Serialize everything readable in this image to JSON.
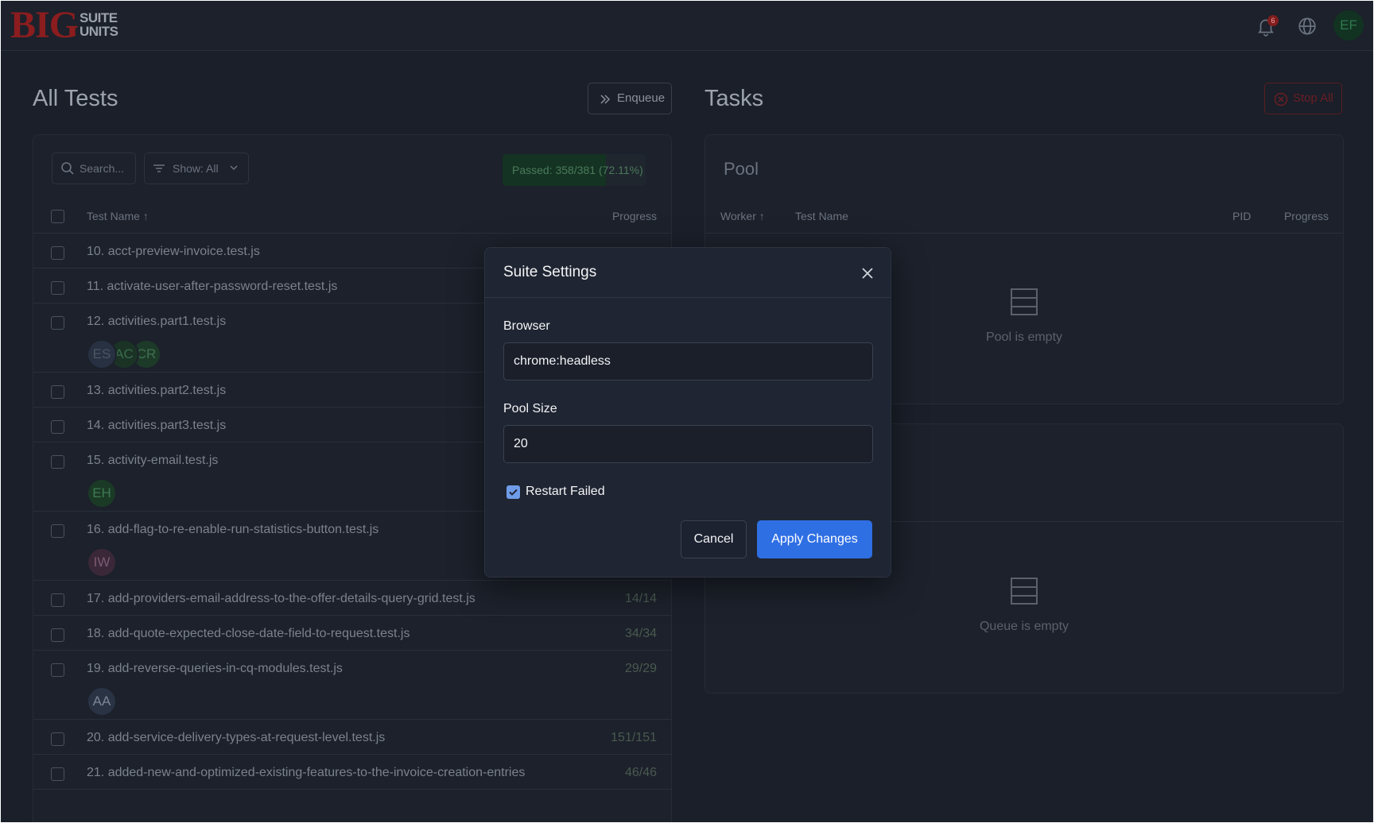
{
  "brand": {
    "big": "BIG",
    "suite": "SUITE",
    "units": "UNITS"
  },
  "header": {
    "notifications_count": "6",
    "user_initials": "EF"
  },
  "all_tests": {
    "title": "All Tests",
    "enqueue_label": "Enqueue",
    "search_placeholder": "Search...",
    "filter_label": "Show: All",
    "passed_summary": "Passed: 358/381 (72.11%)",
    "passed_fraction": 0.72,
    "columns": {
      "test_name": "Test Name",
      "progress": "Progress"
    },
    "rows": [
      {
        "name": "10. acct-preview-invoice.test.js",
        "progress": ""
      },
      {
        "name": "11. activate-user-after-password-reset.test.js",
        "progress": ""
      },
      {
        "name": "12. activities.part1.test.js",
        "progress": "",
        "avatars": [
          "ES",
          "AC",
          "CR"
        ]
      },
      {
        "name": "13. activities.part2.test.js",
        "progress": ""
      },
      {
        "name": "14. activities.part3.test.js",
        "progress": ""
      },
      {
        "name": "15. activity-email.test.js",
        "progress": "",
        "avatars": [
          "EH"
        ]
      },
      {
        "name": "16. add-flag-to-re-enable-run-statistics-button.test.js",
        "progress": "",
        "avatars": [
          "IW"
        ]
      },
      {
        "name": "17. add-providers-email-address-to-the-offer-details-query-grid.test.js",
        "progress": "14/14"
      },
      {
        "name": "18. add-quote-expected-close-date-field-to-request.test.js",
        "progress": "34/34"
      },
      {
        "name": "19. add-reverse-queries-in-cq-modules.test.js",
        "progress": "29/29",
        "avatars": [
          "AA"
        ]
      },
      {
        "name": "20. add-service-delivery-types-at-request-level.test.js",
        "progress": "151/151"
      },
      {
        "name": "21. added-new-and-optimized-existing-features-to-the-invoice-creation-entries",
        "progress": "46/46"
      }
    ]
  },
  "tasks": {
    "title": "Tasks",
    "stop_all_label": "Stop All",
    "pool": {
      "title": "Pool",
      "columns": {
        "worker": "Worker",
        "test_name": "Test Name",
        "pid": "PID",
        "progress": "Progress"
      },
      "empty_label": "Pool is empty"
    },
    "queue": {
      "empty_label": "Queue is empty"
    }
  },
  "modal": {
    "title": "Suite Settings",
    "browser_label": "Browser",
    "browser_value": "chrome:headless",
    "pool_size_label": "Pool Size",
    "pool_size_value": "20",
    "restart_failed_label": "Restart Failed",
    "restart_failed_checked": true,
    "cancel_label": "Cancel",
    "apply_label": "Apply Changes"
  },
  "colors": {
    "background": "#1a1f29",
    "accent": "#2f6fe4",
    "danger": "#6b1d24",
    "brand": "#8b1d1f"
  }
}
